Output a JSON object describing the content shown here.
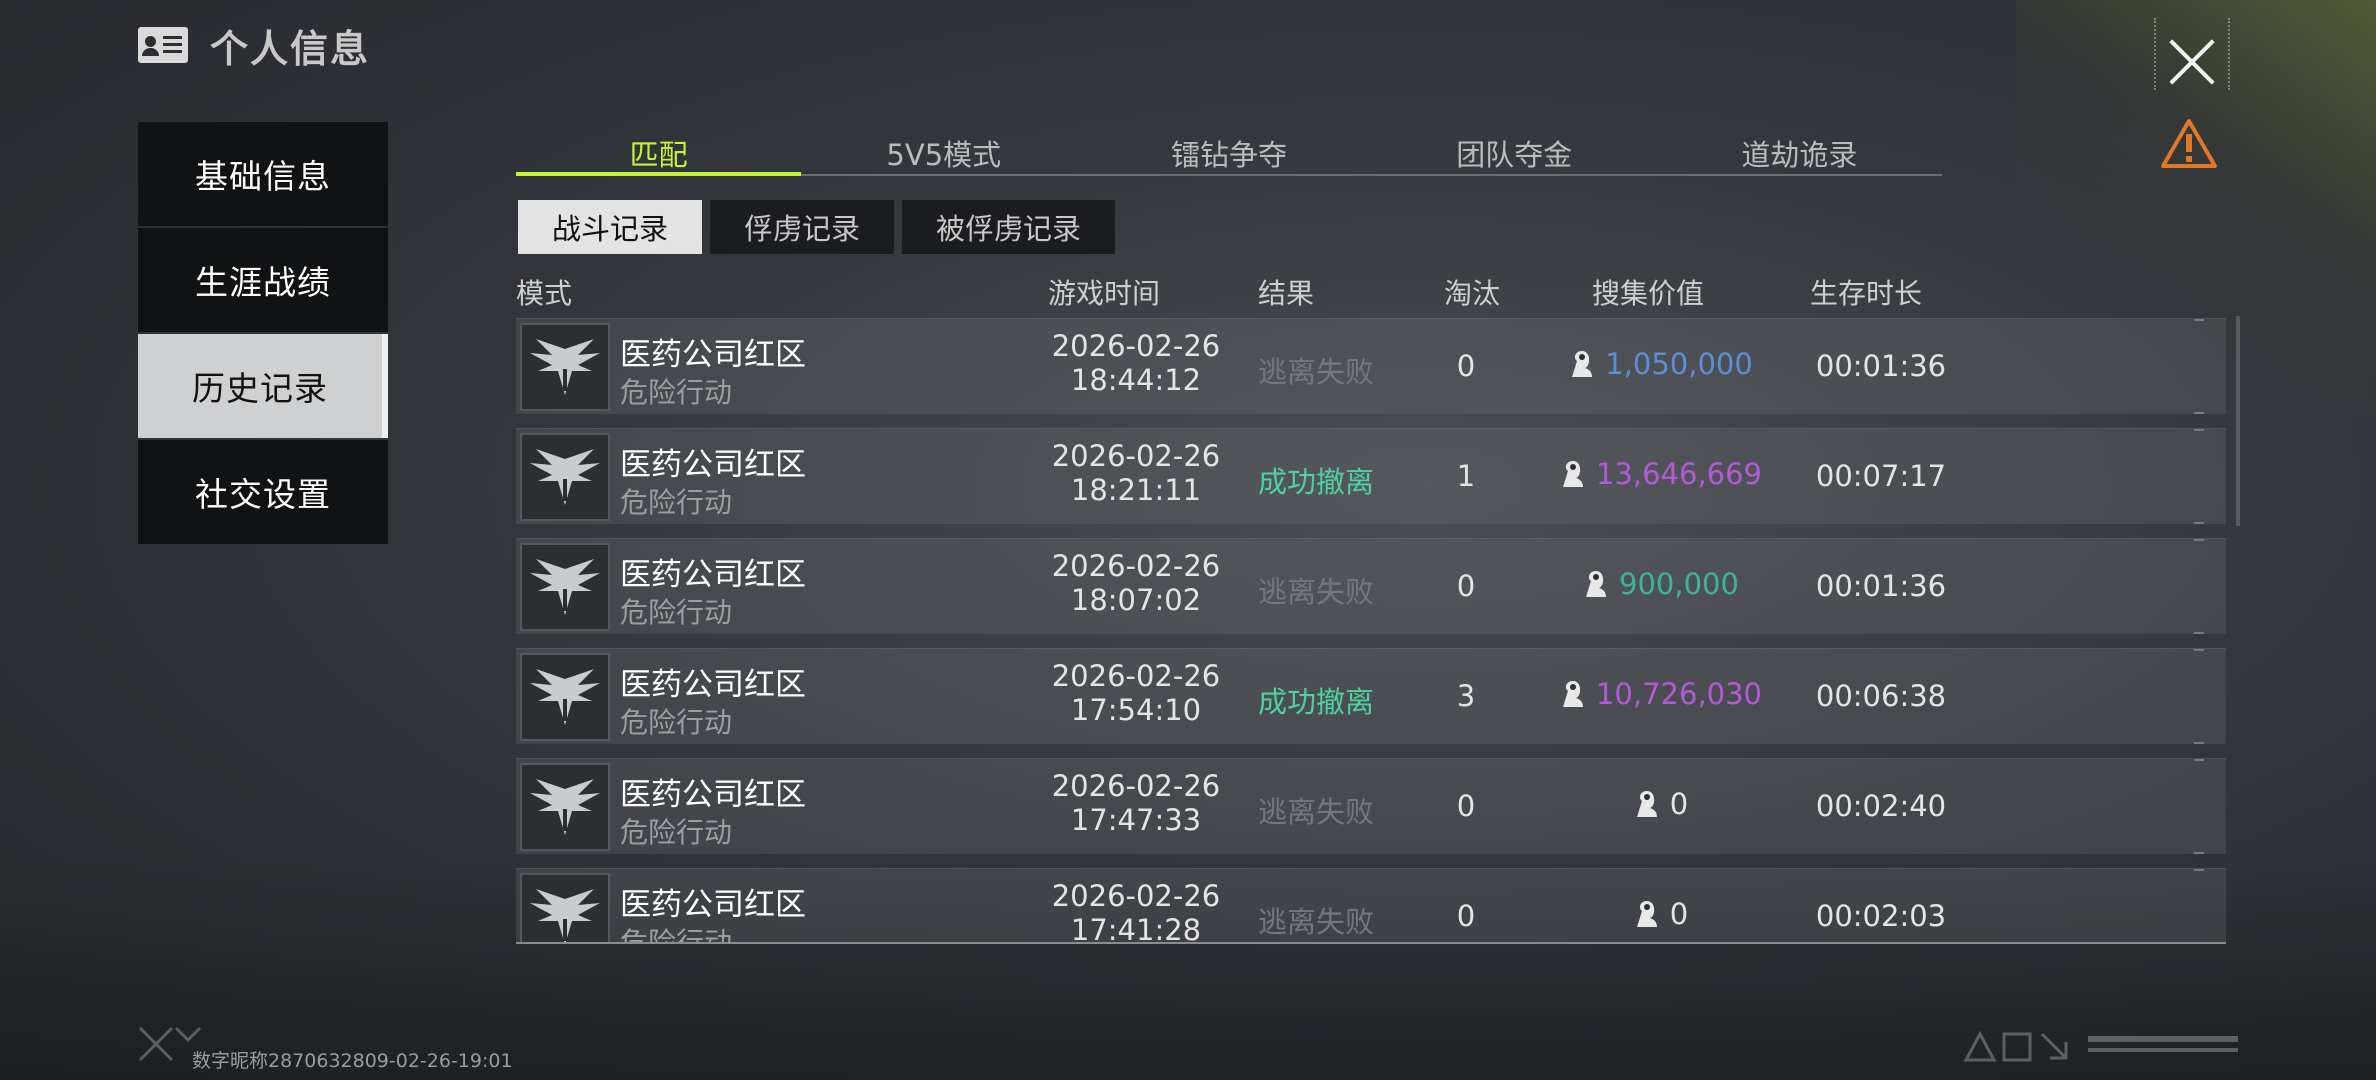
{
  "header": {
    "title": "个人信息"
  },
  "sidebar": {
    "items": [
      {
        "label": "基础信息",
        "active": false
      },
      {
        "label": "生涯战绩",
        "active": false
      },
      {
        "label": "历史记录",
        "active": true
      },
      {
        "label": "社交设置",
        "active": false
      }
    ]
  },
  "tabs": [
    {
      "label": "匹配",
      "active": true
    },
    {
      "label": "5V5模式",
      "active": false
    },
    {
      "label": "镭钻争夺",
      "active": false
    },
    {
      "label": "团队夺金",
      "active": false
    },
    {
      "label": "道劫诡录",
      "active": false
    }
  ],
  "subtabs": [
    {
      "label": "战斗记录",
      "active": true
    },
    {
      "label": "俘虏记录",
      "active": false
    },
    {
      "label": "被俘虏记录",
      "active": false
    }
  ],
  "table": {
    "headers": {
      "mode": "模式",
      "time": "游戏时间",
      "result": "结果",
      "kills": "淘汰",
      "value": "搜集价值",
      "survival": "生存时长"
    },
    "rows": [
      {
        "map": "医药公司红区",
        "mode": "危险行动",
        "date": "2026-02-26",
        "clock": "18:44:12",
        "result": "逃离失败",
        "status": "fail",
        "kills": "0",
        "value": "1,050,000",
        "value_color": "#5b8fd6",
        "survival": "00:01:36"
      },
      {
        "map": "医药公司红区",
        "mode": "危险行动",
        "date": "2026-02-26",
        "clock": "18:21:11",
        "result": "成功撤离",
        "status": "ok",
        "kills": "1",
        "value": "13,646,669",
        "value_color": "#b35bd6",
        "survival": "00:07:17"
      },
      {
        "map": "医药公司红区",
        "mode": "危险行动",
        "date": "2026-02-26",
        "clock": "18:07:02",
        "result": "逃离失败",
        "status": "fail",
        "kills": "0",
        "value": "900,000",
        "value_color": "#3fb39a",
        "survival": "00:01:36"
      },
      {
        "map": "医药公司红区",
        "mode": "危险行动",
        "date": "2026-02-26",
        "clock": "17:54:10",
        "result": "成功撤离",
        "status": "ok",
        "kills": "3",
        "value": "10,726,030",
        "value_color": "#b35bd6",
        "survival": "00:06:38"
      },
      {
        "map": "医药公司红区",
        "mode": "危险行动",
        "date": "2026-02-26",
        "clock": "17:47:33",
        "result": "逃离失败",
        "status": "fail",
        "kills": "0",
        "value": "0",
        "value_color": "#e4e4e4",
        "survival": "00:02:40"
      },
      {
        "map": "医药公司红区",
        "mode": "危险行动",
        "date": "2026-02-26",
        "clock": "17:41:28",
        "result": "逃离失败",
        "status": "fail",
        "kills": "0",
        "value": "0",
        "value_color": "#e4e4e4",
        "survival": "00:02:03"
      }
    ]
  },
  "footer": {
    "text": "数字昵称2870632809-02-26-19:01"
  },
  "icons": {
    "close": "close-icon",
    "report": "warning-icon",
    "id_card": "id-card-icon",
    "coin": "currency-icon",
    "map_emblem": "wing-emblem-icon"
  },
  "colors": {
    "accent": "#c6f23a",
    "success": "#4fd1a0",
    "fail": "#74777b",
    "warning": "#e0782a"
  }
}
